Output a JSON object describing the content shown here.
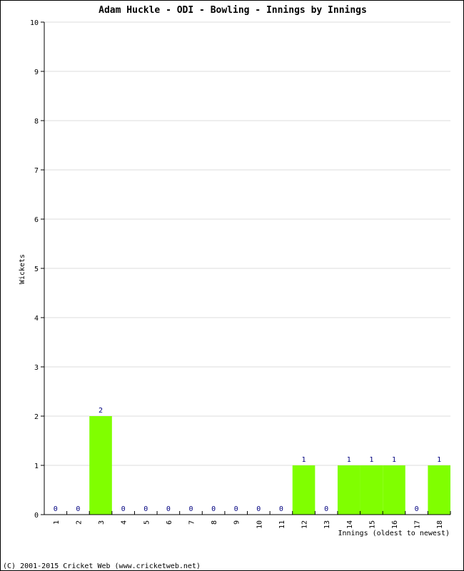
{
  "chart_data": {
    "type": "bar",
    "title": "Adam Huckle - ODI - Bowling - Innings by Innings",
    "xlabel": "Innings (oldest to newest)",
    "ylabel": "Wickets",
    "ylim": [
      0,
      10
    ],
    "yticks": [
      0,
      1,
      2,
      3,
      4,
      5,
      6,
      7,
      8,
      9,
      10
    ],
    "grid": true,
    "categories": [
      "1",
      "2",
      "3",
      "4",
      "5",
      "6",
      "7",
      "8",
      "9",
      "10",
      "11",
      "12",
      "13",
      "14",
      "15",
      "16",
      "17",
      "18"
    ],
    "values": [
      0,
      0,
      2,
      0,
      0,
      0,
      0,
      0,
      0,
      0,
      0,
      1,
      0,
      1,
      1,
      1,
      0,
      1
    ],
    "bar_color": "#80ff00",
    "value_label_color": "#000080",
    "gridline_color": "#dddddd"
  },
  "footer": "(C) 2001-2015 Cricket Web (www.cricketweb.net)"
}
